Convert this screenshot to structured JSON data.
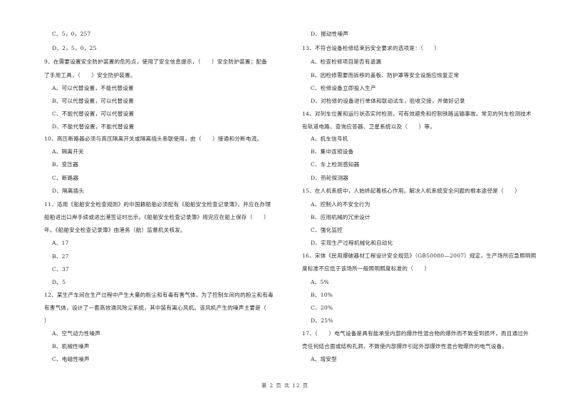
{
  "left_column": [
    {
      "text": "C、5，0，257",
      "kind": "option"
    },
    {
      "text": "D、2，5，0，25",
      "kind": "option"
    },
    {
      "text": "9、在需要设置安全防护装置的危险点，使用了安全信息提示，（　　）安全防护装置；配备",
      "kind": "question"
    },
    {
      "text": "了手用工具，（　　）安全防护装置。",
      "kind": "question-cont"
    },
    {
      "text": "A、可以代替设置，不能代替设置",
      "kind": "option"
    },
    {
      "text": "B、可以代替设置，可以代替设置",
      "kind": "option"
    },
    {
      "text": "C、不能代替设置，可以代替设置",
      "kind": "option"
    },
    {
      "text": "D、不能代替设置，不能代替设置",
      "kind": "option"
    },
    {
      "text": "10、高压断路器必须与高压隔离开关或隔离插头串联使用，由（　　）接通和分断电流。",
      "kind": "question"
    },
    {
      "text": "A、隔离开关",
      "kind": "option"
    },
    {
      "text": "B、变压器",
      "kind": "option"
    },
    {
      "text": "C、断路器",
      "kind": "option"
    },
    {
      "text": "D、隔离插头",
      "kind": "option"
    },
    {
      "text": "11、适用《船舶安全检查规则》的中国籍船舶必须配有《船舶安全检查记录簿》，并应在办理",
      "kind": "question"
    },
    {
      "text": "船舶进出口岸手续或进出港签证时出示。《船舶安全检查记录簿》用完应在船上保存（　　）",
      "kind": "question-cont"
    },
    {
      "text": "年。《船舶安全检查记录簿》由港务（航）监督机关核发。",
      "kind": "question-cont"
    },
    {
      "text": "A、17",
      "kind": "option"
    },
    {
      "text": "B、27",
      "kind": "option"
    },
    {
      "text": "C、37",
      "kind": "option"
    },
    {
      "text": "D、5",
      "kind": "option"
    },
    {
      "text": "12、某生产车间在生产过程中产生大量的粉尘和有毒有害气体。为了控制车间内的粉尘和有毒",
      "kind": "question"
    },
    {
      "text": "有害气体，设计了一套高效通风除尘系统，其中装有离心风机。该风机产生的噪声主要是（",
      "kind": "question-cont"
    },
    {
      "text": "）",
      "kind": "question-cont"
    },
    {
      "text": "A、空气动力性噪声",
      "kind": "option"
    },
    {
      "text": "B、机械性噪声",
      "kind": "option"
    },
    {
      "text": "C、电磁性噪声",
      "kind": "option"
    }
  ],
  "right_column": [
    {
      "text": "D、振动性噪声",
      "kind": "option"
    },
    {
      "text": "13、不符合设备检修结束后安全要求的选项是：（　　）",
      "kind": "question"
    },
    {
      "text": "A、检查检修项目是否有遗漏",
      "kind": "option"
    },
    {
      "text": "B、因检修需要而拆移的盖板、防护罩等安全设施应恢复正常",
      "kind": "option"
    },
    {
      "text": "C、检修设备立即投入生产",
      "kind": "option"
    },
    {
      "text": "D、对检修的设备进行单体和联动试车，验收交接，并做好记录",
      "kind": "option"
    },
    {
      "text": "14、对列车位置和运行状态实时检测，可有效避免和控制铁路运输事故。常见的列车检测技术",
      "kind": "question"
    },
    {
      "text": "有轨道电路、查询应答器、卫星系统以及（　　）等。",
      "kind": "question-cont"
    },
    {
      "text": "A、机车信号机",
      "kind": "option"
    },
    {
      "text": "B、集中连锁设备",
      "kind": "option"
    },
    {
      "text": "C、车上检测感知器",
      "kind": "option"
    },
    {
      "text": "D、热轮探测器",
      "kind": "option"
    },
    {
      "text": "15、在人机系统中，人始终起着核心作用。解决人机系统安全问题的根本途径是（　　）",
      "kind": "question"
    },
    {
      "text": "A、控制人的不安全行为",
      "kind": "option"
    },
    {
      "text": "B、应用机械的冗余设计",
      "kind": "option"
    },
    {
      "text": "C、强化监控",
      "kind": "option"
    },
    {
      "text": "D、实现生产过程机械化和自动化",
      "kind": "option"
    },
    {
      "text": "16、宋体《民用爆破器材工程设计安全规范》（GB50080—2007）规定，生产场所应急照明照",
      "kind": "question"
    },
    {
      "text": "度标准不应低于该场所一般照明照度标准的（　　）",
      "kind": "question-cont"
    },
    {
      "text": "A、5%",
      "kind": "option"
    },
    {
      "text": "B、10%",
      "kind": "option"
    },
    {
      "text": "C、20%",
      "kind": "option"
    },
    {
      "text": "D、25%",
      "kind": "option"
    },
    {
      "text": "17、（　　）电气设备是具有能承受内部的爆炸性混合物的爆炸而不致受到损坏，而且通过外",
      "kind": "question"
    },
    {
      "text": "壳任何结合面或结构孔洞，不致使内部爆炸引起外部爆炸性混合物爆炸的电气设备。",
      "kind": "question-cont"
    },
    {
      "text": "A、增安型",
      "kind": "option"
    }
  ],
  "footer": {
    "page_label": "第 2 页 共 12 页"
  }
}
